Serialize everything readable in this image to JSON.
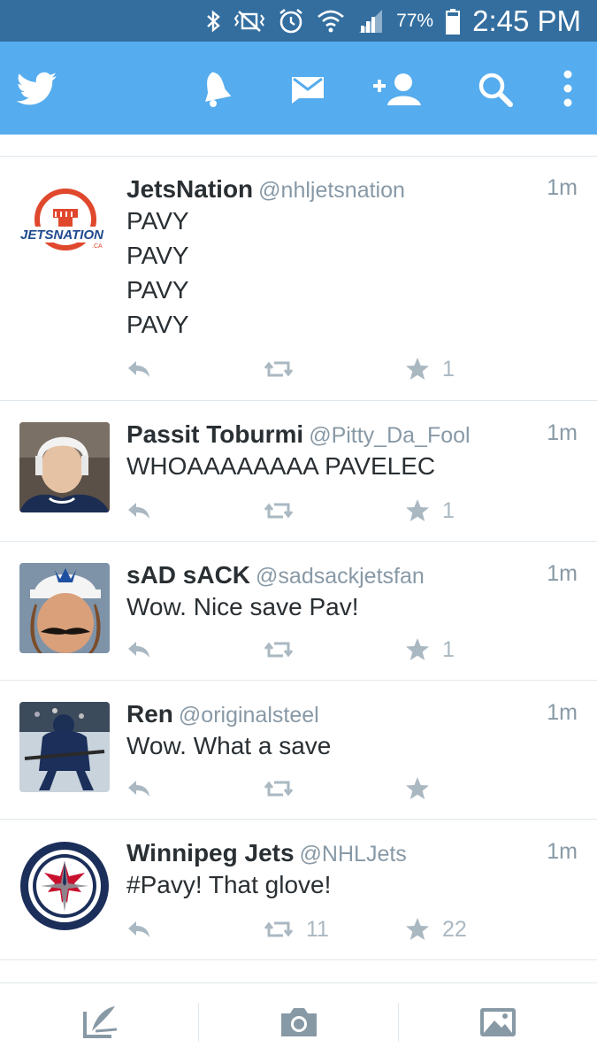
{
  "status_bar": {
    "battery": "77%",
    "time": "2:45 PM",
    "icons": [
      "bluetooth-icon",
      "vibrate-mute-icon",
      "alarm-icon",
      "wifi-icon",
      "signal-icon",
      "battery-icon"
    ]
  },
  "app_bar": {
    "icons": [
      "twitter-logo-icon",
      "notifications-bell-icon",
      "messages-envelope-icon",
      "add-user-icon",
      "search-icon",
      "overflow-menu-icon"
    ],
    "color": "#55acee"
  },
  "tweets": [
    {
      "name": "JetsNation",
      "handle": "@nhljetsnation",
      "time": "1m",
      "lines": [
        "PAVY",
        "PAVY",
        "PAVY",
        "PAVY"
      ],
      "retweets": "",
      "favorites": "1",
      "avatar_logo": "JETSNATION",
      "avatar_logo_sub": ".CA"
    },
    {
      "name": "Passit Toburmi",
      "handle": "@Pitty_Da_Fool",
      "time": "1m",
      "lines": [
        "WHOAAAAAAAA PAVELEC"
      ],
      "retweets": "",
      "favorites": "1"
    },
    {
      "name": "sAD sACK",
      "handle": "@sadsackjetsfan",
      "time": "1m",
      "lines": [
        "Wow. Nice save Pav!"
      ],
      "retweets": "",
      "favorites": "1"
    },
    {
      "name": "Ren",
      "handle": "@originalsteel",
      "time": "1m",
      "lines": [
        "Wow. What a save"
      ],
      "retweets": "",
      "favorites": ""
    },
    {
      "name": "Winnipeg Jets",
      "handle": "@NHLJets",
      "time": "1m",
      "lines": [
        "#Pavy! That glove!"
      ],
      "retweets": "11",
      "favorites": "22"
    }
  ],
  "bottom_bar": {
    "icons": [
      "compose-tweet-icon",
      "camera-icon",
      "gallery-image-icon"
    ]
  }
}
